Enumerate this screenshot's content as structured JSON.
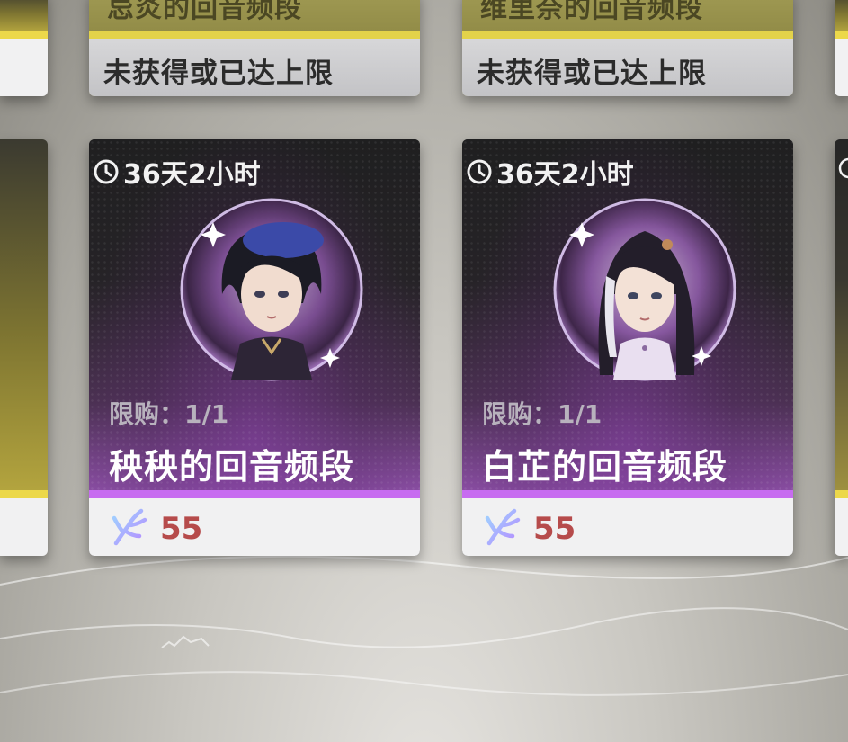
{
  "top_cards": [
    {
      "title": "忌炎的回音频段",
      "status": "未获得或已达上限"
    },
    {
      "title": "维里奈的回音频段",
      "status": "未获得或已达上限"
    }
  ],
  "shop_cards": [
    {
      "timer": "36天2小时",
      "limit": "限购：1/1",
      "name": "秧秧的回音频段",
      "price": "55",
      "portrait_icon": "yangyang-portrait-icon"
    },
    {
      "timer": "36天2小时",
      "limit": "限购：1/1",
      "name": "白芷的回音频段",
      "price": "55",
      "portrait_icon": "baizhi-portrait-icon"
    }
  ],
  "colors": {
    "gold_stripe": "#e3d24a",
    "purple_stripe": "#c76cf0",
    "price_red": "#b64b4b"
  },
  "icons": {
    "timer": "clock-icon",
    "currency": "coral-currency-icon"
  }
}
